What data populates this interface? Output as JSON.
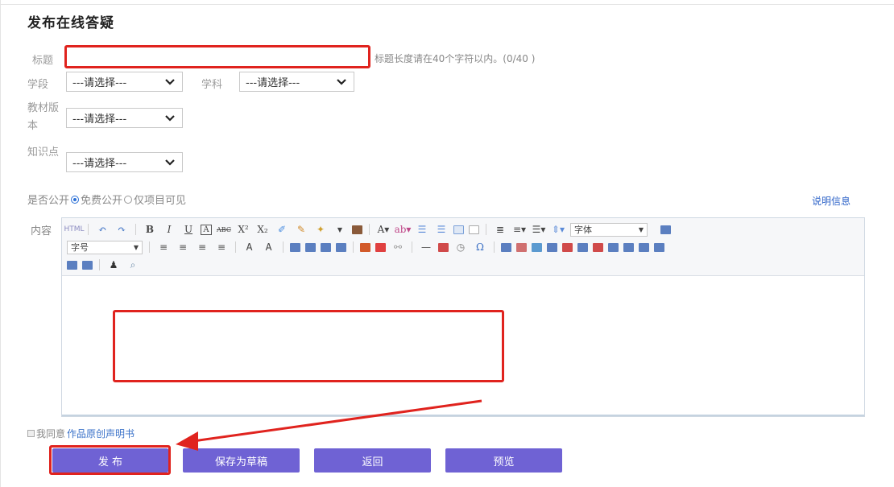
{
  "page": {
    "title": "发布在线答疑"
  },
  "form": {
    "title_label": "标题",
    "title_value": "",
    "title_hint": "标题长度请在40个字符以内。(0/40 )",
    "stage_label": "学段",
    "stage_value": "---请选择---",
    "subject_label": "学科",
    "subject_value": "---请选择---",
    "textbook_label": "教材版本",
    "textbook_value": "---请选择---",
    "knowledge_label": "知识点",
    "knowledge_value": "---请选择---",
    "public_label": "是否公开",
    "public_options": [
      "免费公开",
      "仅项目可见"
    ],
    "public_selected": "免费公开",
    "info_link": "说明信息",
    "content_label": "内容"
  },
  "editor": {
    "font_family_label": "字体",
    "font_size_label": "字号",
    "html_button": "HTML"
  },
  "agree": {
    "prefix": "我同意",
    "link": "作品原创声明书"
  },
  "buttons": {
    "publish": "发 布",
    "save_draft": "保存为草稿",
    "back": "返回",
    "preview": "预览"
  },
  "colors": {
    "accent": "#6f62d4",
    "highlight_red": "#e0231e",
    "link_blue": "#2d63c8"
  }
}
